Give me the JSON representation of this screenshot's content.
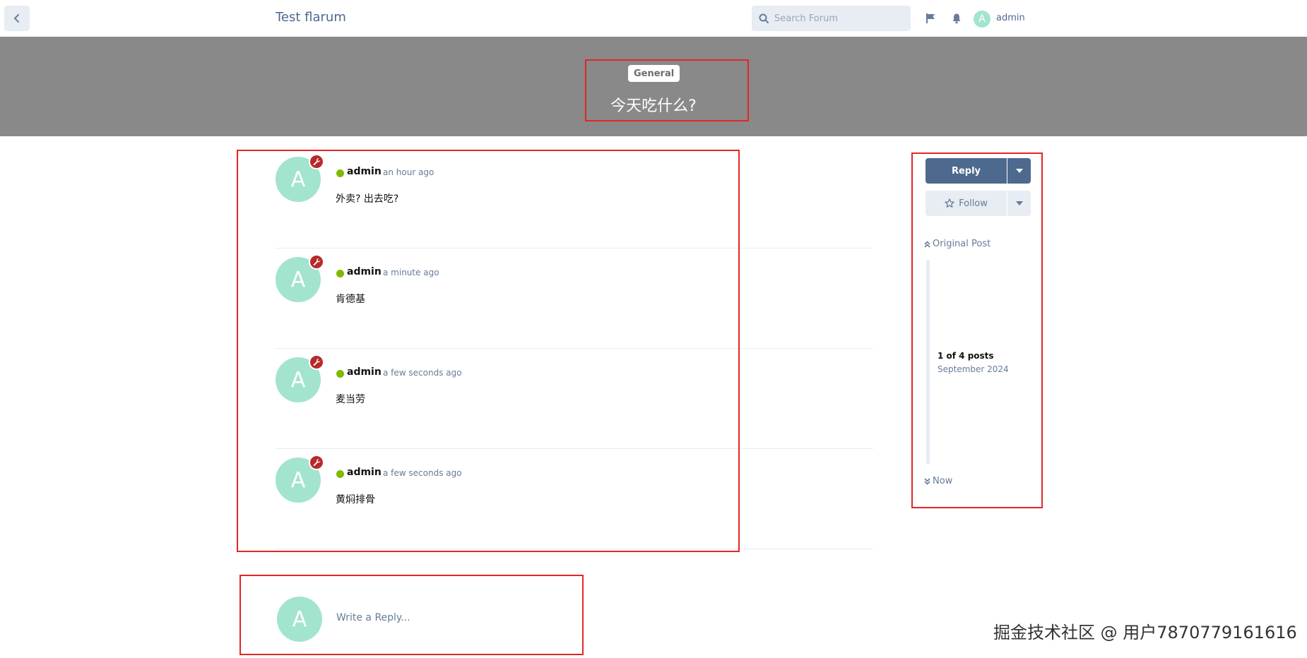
{
  "header": {
    "forum_title": "Test flarum",
    "search_placeholder": "Search Forum",
    "user_initial": "A",
    "username": "admin"
  },
  "discussion": {
    "tag": "General",
    "title": "今天吃什么?"
  },
  "posts": [
    {
      "initial": "A",
      "author": "admin",
      "time": "an hour ago",
      "content": "外卖? 出去吃?"
    },
    {
      "initial": "A",
      "author": "admin",
      "time": "a minute ago",
      "content": "肯德基"
    },
    {
      "initial": "A",
      "author": "admin",
      "time": "a few seconds ago",
      "content": "麦当劳"
    },
    {
      "initial": "A",
      "author": "admin",
      "time": "a few seconds ago",
      "content": "黄焖排骨"
    }
  ],
  "composer": {
    "initial": "A",
    "placeholder": "Write a Reply..."
  },
  "sidebar": {
    "reply_label": "Reply",
    "follow_label": "Follow",
    "original_post_label": "Original Post",
    "post_count": "1 of 4 posts",
    "post_date": "September 2024",
    "now_label": "Now"
  },
  "watermark": "掘金技术社区 @ 用户7870779161616",
  "colors": {
    "primary": "#4d698e",
    "hero": "#898989",
    "avatar": "#a3e4cf",
    "mod_badge": "#b72a2a",
    "online": "#7fba00",
    "annotation": "#e32626"
  }
}
